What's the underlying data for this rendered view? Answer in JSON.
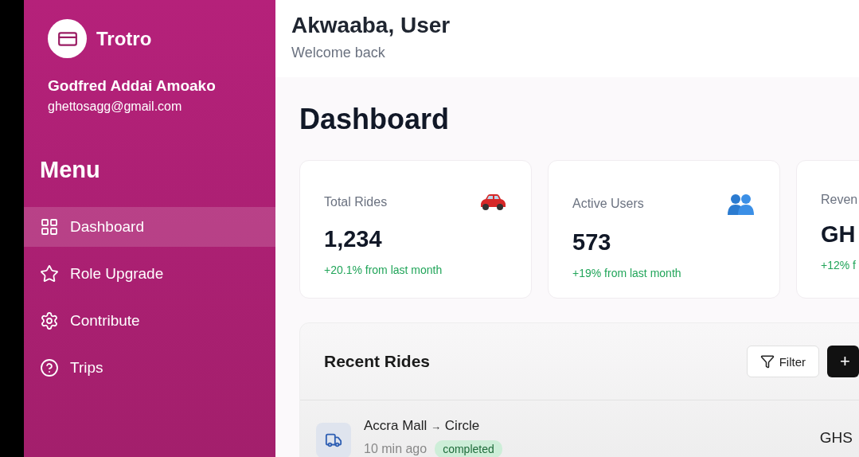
{
  "brand": {
    "name": "Trotro"
  },
  "user": {
    "name": "Godfred Addai Amoako",
    "email": "ghettosagg@gmail.com"
  },
  "menu": {
    "title": "Menu",
    "items": [
      {
        "label": "Dashboard",
        "selected": true
      },
      {
        "label": "Role Upgrade",
        "selected": false
      },
      {
        "label": "Contribute",
        "selected": false
      },
      {
        "label": "Trips",
        "selected": false
      }
    ]
  },
  "header": {
    "title": "Akwaaba, User",
    "subtitle": "Welcome back"
  },
  "page_title": "Dashboard",
  "stats": [
    {
      "label": "Total Rides",
      "value": "1,234",
      "change": "+20.1% from last month"
    },
    {
      "label": "Active Users",
      "value": "573",
      "change": "+19% from last month"
    },
    {
      "label": "Reven",
      "value": "GH",
      "change": "+12% f"
    }
  ],
  "recent_rides": {
    "title": "Recent Rides",
    "filter_button": "Filter",
    "add_button": "+",
    "rows": [
      {
        "route_from": "Accra Mall",
        "arrow": "→",
        "route_to": "Circle",
        "time": "10 min ago",
        "status": "completed",
        "amount": "GHS"
      }
    ]
  }
}
